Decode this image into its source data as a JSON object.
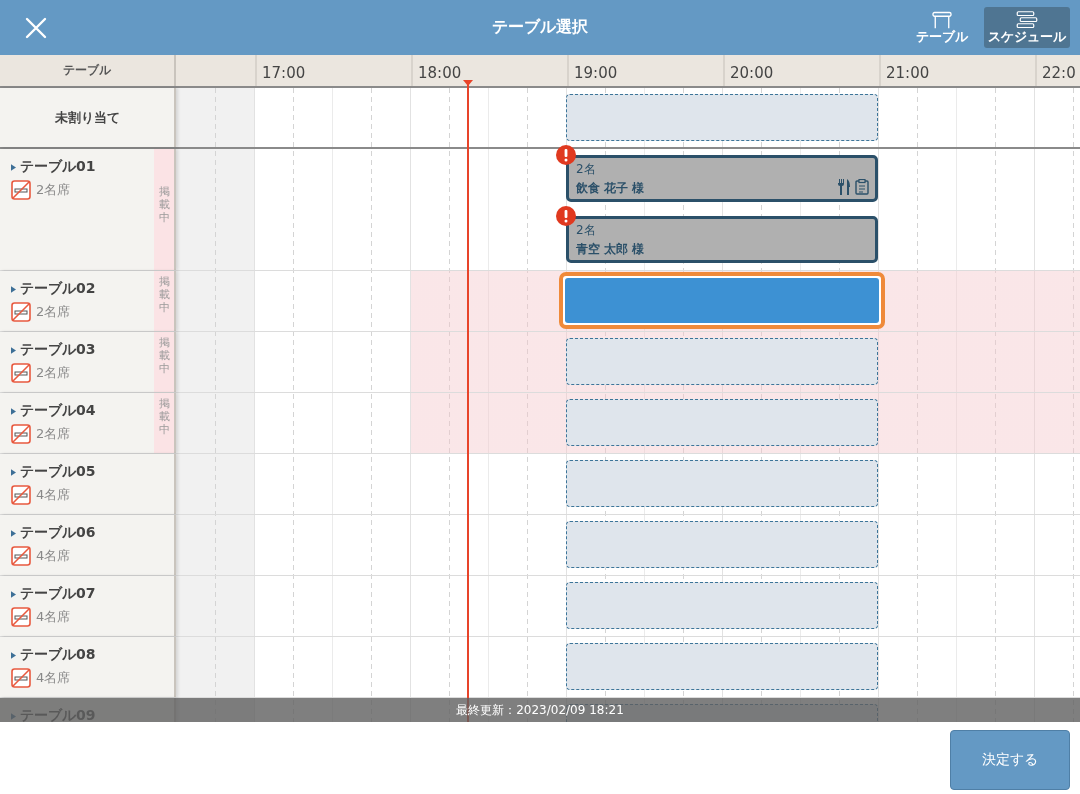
{
  "header": {
    "title": "テーブル選択",
    "tabs": [
      {
        "label": "テーブル",
        "kind": "table",
        "selected": false
      },
      {
        "label": "スケジュール",
        "kind": "schedule",
        "selected": true
      }
    ]
  },
  "timeline": {
    "column_header": "テーブル",
    "hours": [
      "17:00",
      "18:00",
      "19:00",
      "20:00",
      "21:00",
      "22:0"
    ],
    "now_line": true
  },
  "unassigned": {
    "label": "未割り当て",
    "slots": [
      {
        "kind": "empty"
      }
    ]
  },
  "tables": [
    {
      "name": "テーブル01",
      "seats": "2名席",
      "status": "掲載中",
      "blocked": false,
      "slots": [
        {
          "kind": "booking",
          "guests": "2名",
          "name": "飲食 花子 様",
          "warning": true,
          "meal_icon": true,
          "memo_icon": true
        },
        {
          "kind": "booking",
          "guests": "2名",
          "name": "青空 太郎 様",
          "warning": true
        }
      ]
    },
    {
      "name": "テーブル02",
      "seats": "2名席",
      "status": "掲載中",
      "blocked": true,
      "slots": [
        {
          "kind": "selected"
        }
      ]
    },
    {
      "name": "テーブル03",
      "seats": "2名席",
      "status": "掲載中",
      "blocked": true,
      "slots": [
        {
          "kind": "empty"
        }
      ]
    },
    {
      "name": "テーブル04",
      "seats": "2名席",
      "status": "掲載中",
      "blocked": true,
      "slots": [
        {
          "kind": "empty"
        }
      ]
    },
    {
      "name": "テーブル05",
      "seats": "4名席",
      "blocked": false,
      "slots": [
        {
          "kind": "empty"
        }
      ]
    },
    {
      "name": "テーブル06",
      "seats": "4名席",
      "blocked": false,
      "slots": [
        {
          "kind": "empty"
        }
      ]
    },
    {
      "name": "テーブル07",
      "seats": "4名席",
      "blocked": false,
      "slots": [
        {
          "kind": "empty"
        }
      ]
    },
    {
      "name": "テーブル08",
      "seats": "4名席",
      "blocked": false,
      "slots": [
        {
          "kind": "empty"
        }
      ]
    },
    {
      "name": "テーブル09",
      "slots": [
        {
          "kind": "empty"
        }
      ]
    }
  ],
  "footer": {
    "last_updated": "最終更新：2023/02/09 18:21"
  },
  "confirm_button": "決定する"
}
